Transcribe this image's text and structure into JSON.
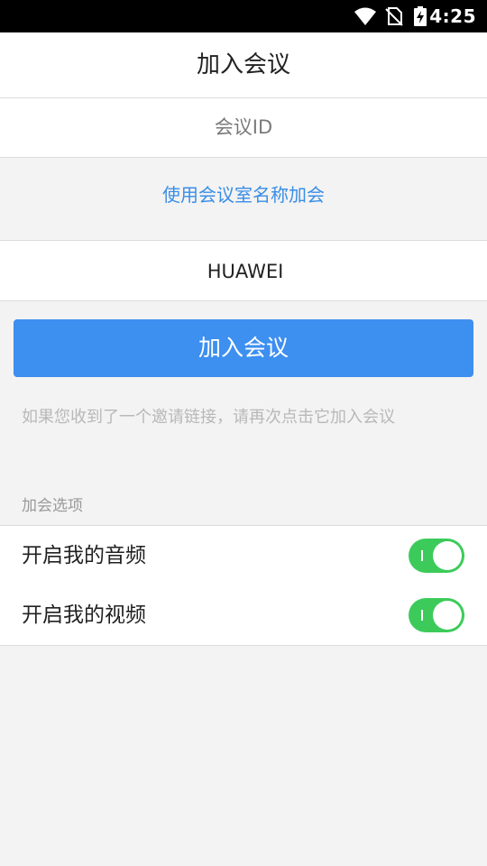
{
  "status_bar": {
    "time": "4:25"
  },
  "header": {
    "title": "加入会议"
  },
  "meeting_id": {
    "label": "会议ID"
  },
  "room_name_link": "使用会议室名称加会",
  "room_name_input": {
    "value": "HUAWEI"
  },
  "join_button": "加入会议",
  "hint": "如果您收到了一个邀请链接，请再次点击它加入会议",
  "options": {
    "header": "加会选项",
    "items": [
      {
        "label": "开启我的音频",
        "enabled": true
      },
      {
        "label": "开启我的视频",
        "enabled": true
      }
    ]
  },
  "colors": {
    "accent": "#3d8ff0",
    "toggle_on": "#3ccb5a",
    "link": "#3a8ee6"
  }
}
